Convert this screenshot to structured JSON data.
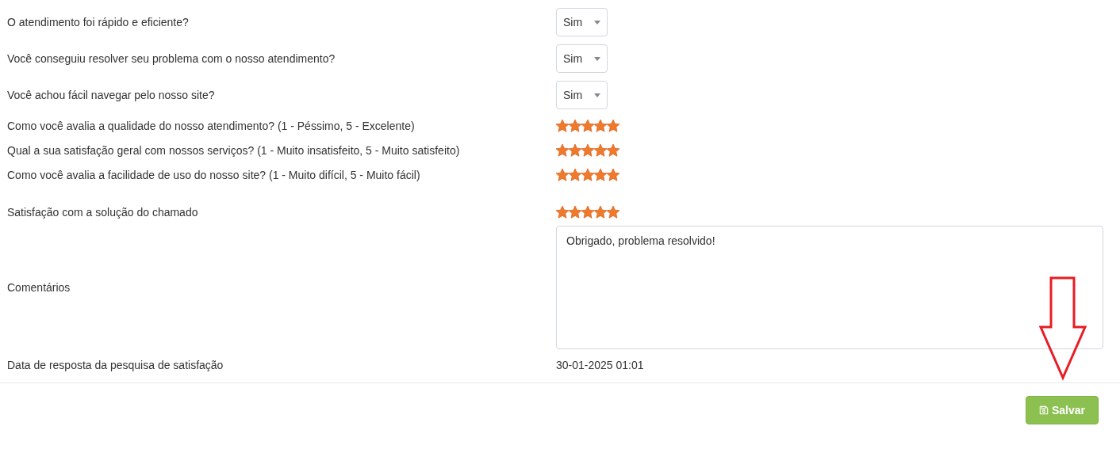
{
  "questions": [
    {
      "kind": "select",
      "label": "O atendimento foi rápido e eficiente?",
      "value": "Sim"
    },
    {
      "kind": "select",
      "label": "Você conseguiu resolver seu problema com o nosso atendimento?",
      "value": "Sim"
    },
    {
      "kind": "select",
      "label": "Você achou fácil navegar pelo nosso site?",
      "value": "Sim"
    },
    {
      "kind": "stars",
      "label": "Como você avalia a qualidade do nosso atendimento? (1 - Péssimo, 5 - Excelente)",
      "stars": 5
    },
    {
      "kind": "stars",
      "label": "Qual a sua satisfação geral com nossos serviços? (1 - Muito insatisfeito, 5 - Muito satisfeito)",
      "stars": 5
    },
    {
      "kind": "stars",
      "label": "Como você avalia a facilidade de uso do nosso site? (1 - Muito difícil, 5 - Muito fácil)",
      "stars": 5
    },
    {
      "kind": "stars",
      "label": "Satisfação com a solução do chamado",
      "stars": 5
    },
    {
      "kind": "textarea",
      "label": "Comentários",
      "value": "Obrigado, problema resolvido!"
    },
    {
      "kind": "text",
      "label": "Data de resposta da pesquisa de satisfação",
      "value": "30-01-2025 01:01"
    }
  ],
  "save_button": {
    "label": "Salvar"
  }
}
